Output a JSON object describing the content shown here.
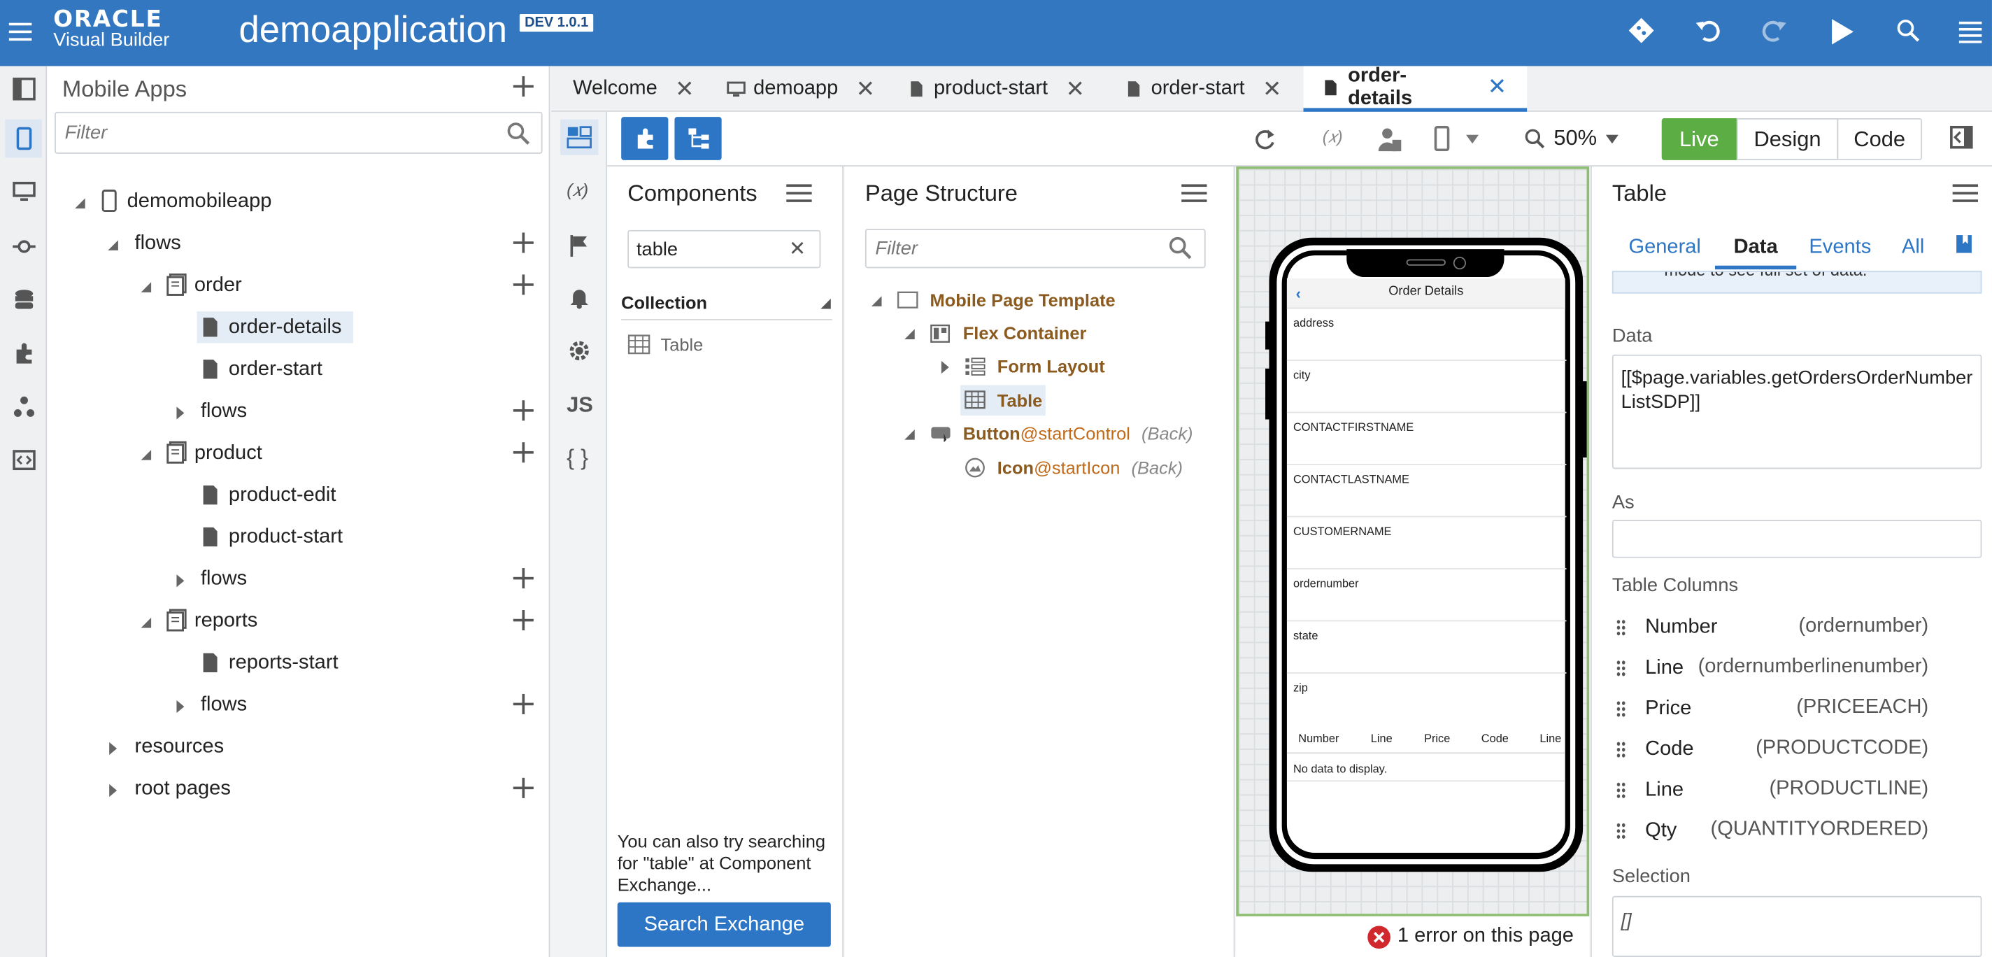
{
  "header": {
    "logo_top": "ORACLE",
    "logo_bottom": "Visual Builder",
    "app_name": "demoapplication",
    "version": "DEV 1.0.1"
  },
  "nav": {
    "title": "Mobile Apps",
    "filter_placeholder": "Filter",
    "tree": {
      "app": "demomobileapp",
      "flows": "flows",
      "order": "order",
      "order_details": "order-details",
      "order_start": "order-start",
      "order_flows": "flows",
      "product": "product",
      "product_edit": "product-edit",
      "product_start": "product-start",
      "product_flows": "flows",
      "reports": "reports",
      "reports_start": "reports-start",
      "reports_flows": "flows",
      "resources": "resources",
      "root_pages": "root pages"
    }
  },
  "tabs": [
    {
      "label": "Welcome"
    },
    {
      "label": "demoapp"
    },
    {
      "label": "product-start"
    },
    {
      "label": "order-start"
    },
    {
      "label": "order-details"
    }
  ],
  "toolbar": {
    "zoom": "50%",
    "live": "Live",
    "design": "Design",
    "code": "Code"
  },
  "components": {
    "title": "Components",
    "search_value": "table",
    "section": "Collection",
    "item": "Table",
    "hint": "You can also try searching for \"table\" at Component Exchange...",
    "search_button": "Search Exchange"
  },
  "page_structure": {
    "title": "Page Structure",
    "filter_placeholder": "Filter",
    "nodes": {
      "template": "Mobile Page Template",
      "flex": "Flex Container",
      "form": "Form Layout",
      "table": "Table",
      "button": "Button",
      "button_id": "@startControl",
      "button_note": "(Back)",
      "icon": "Icon",
      "icon_id": "@startIcon",
      "icon_note": "(Back)"
    }
  },
  "phone": {
    "title": "Order Details",
    "fields": [
      "address",
      "city",
      "CONTACTFIRSTNAME",
      "CONTACTLASTNAME",
      "CUSTOMERNAME",
      "ordernumber",
      "state",
      "zip"
    ],
    "columns": [
      "Number",
      "Line",
      "Price",
      "Code",
      "Line"
    ],
    "empty": "No data to display."
  },
  "canvas_footer": {
    "error": "1 error on this page"
  },
  "properties": {
    "title": "Table",
    "tabs": {
      "general": "General",
      "data": "Data",
      "events": "Events",
      "all": "All"
    },
    "notice_partial": "mode to see full set of data.",
    "data_label": "Data",
    "data_value": "[[$page.variables.getOrdersOrderNumberListSDP]]",
    "as_label": "As",
    "columns_label": "Table Columns",
    "columns": [
      {
        "name": "Number",
        "field": "(ordernumber)"
      },
      {
        "name": "Line",
        "field": "(ordernumberlinenumber)"
      },
      {
        "name": "Price",
        "field": "(PRICEEACH)"
      },
      {
        "name": "Code",
        "field": "(PRODUCTCODE)"
      },
      {
        "name": "Line",
        "field": "(PRODUCTLINE)"
      },
      {
        "name": "Qty",
        "field": "(QUANTITYORDERED)"
      }
    ],
    "selection_label": "Selection",
    "selection_value": "[]"
  },
  "colors": {
    "header": "#3377c0",
    "accent": "#2d76c5",
    "live": "#5cad43",
    "node_brown": "#8a5a1f",
    "id_orange": "#c06a1a"
  }
}
